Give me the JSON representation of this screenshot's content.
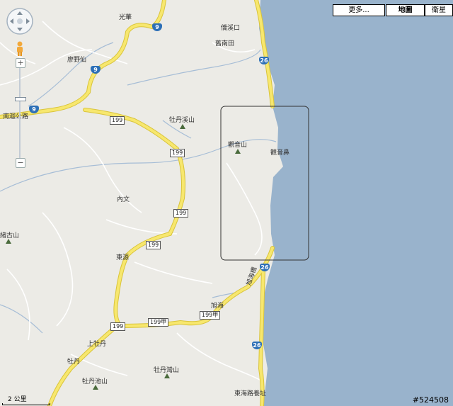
{
  "map_type_buttons": {
    "more": "更多...",
    "map": "地圖",
    "satellite": "衛星"
  },
  "colors": {
    "sea": "#99b3cc",
    "land": "#ecebe6",
    "road": "#f7e76e",
    "road_border": "#d9c43a",
    "river": "#99b3cc"
  },
  "places": {
    "guanghua": "光華",
    "jiananli": "僑溪口",
    "nanlitian": "舊南田",
    "liaoyewu": "廖野仙",
    "nanyu": "南迴公路",
    "mudanxishan": "牡丹溪山",
    "guanyinshan": "觀音山",
    "guanyinbi": "觀音鼻",
    "neiwen": "內文",
    "shiliugushan": "緒古山",
    "dongyuan": "東源",
    "xuhai": "旭海",
    "xuhaibridge": "旭海橋",
    "shangmudan": "上牡丹",
    "mudan": "牡丹",
    "mudanlaoshan": "牡丹灣山",
    "mudanchishan": "牡丹池山",
    "donghailu": "東海路養址"
  },
  "roads": {
    "r9": "9",
    "r26": "26",
    "r199": "199",
    "r199jia": "199甲"
  },
  "scale": "2 公里",
  "watermark": "#524508",
  "icons": {
    "pan": "pan-control-icon",
    "pegman": "pegman-icon",
    "zoom_in": "plus-icon",
    "zoom_out": "minus-icon",
    "peak": "mountain-peak-icon"
  }
}
